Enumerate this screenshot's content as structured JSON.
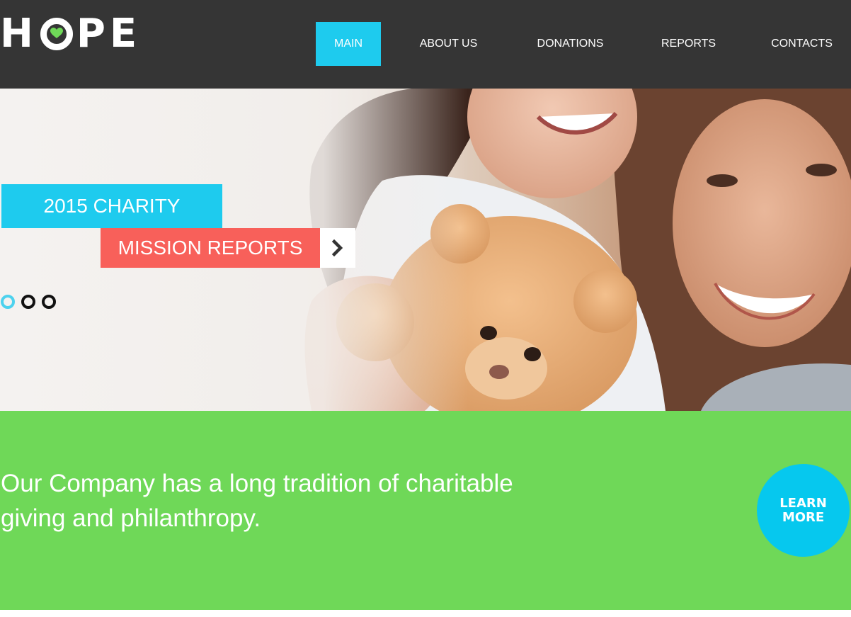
{
  "logo": {
    "letters_before": "H",
    "letters_after": "PE",
    "heart_color": "#6fd858"
  },
  "nav": {
    "items": [
      {
        "label": "MAIN",
        "active": true
      },
      {
        "label": "ABOUT US",
        "active": false
      },
      {
        "label": "DONATIONS",
        "active": false
      },
      {
        "label": "REPORTS",
        "active": false
      },
      {
        "label": "CONTACTS",
        "active": false
      }
    ]
  },
  "hero": {
    "banner_line1": "2015 CHARITY",
    "banner_line2": "MISSION REPORTS",
    "arrow_icon": "chevron-right-icon",
    "slides": [
      {
        "active": true
      },
      {
        "active": false
      },
      {
        "active": false
      }
    ]
  },
  "promo": {
    "tagline": "Our Company has a long tradition of charitable giving and philanthropy.",
    "cta_label": "LEARN\nMORE"
  },
  "colors": {
    "header_bg": "#353535",
    "accent_cyan": "#1ecbee",
    "accent_coral": "#f8605a",
    "green": "#6fd858"
  }
}
